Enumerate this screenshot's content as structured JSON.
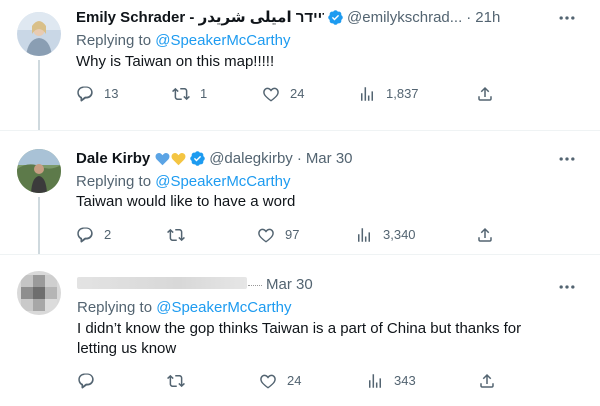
{
  "tweets": [
    {
      "name": "Emily Schrader - אמילי שריידר امیلی شریدر",
      "handle": "@emilykschrad...",
      "time": "21h",
      "replying_label": "Replying to ",
      "replying_to": "@SpeakerMcCarthy",
      "text": "Why is Taiwan on this map!!!!!",
      "replies": "13",
      "retweets": "1",
      "likes": "24",
      "views": "1,837"
    },
    {
      "name": "Dale Kirby",
      "handle": "@dalegkirby",
      "time": "Mar 30",
      "replying_label": "Replying to ",
      "replying_to": "@SpeakerMcCarthy",
      "text": "Taiwan would like to have a word",
      "replies": "2",
      "retweets": "",
      "likes": "97",
      "views": "3,340"
    },
    {
      "name": "",
      "handle": "",
      "time": "Mar 30",
      "replying_label": "Replying to ",
      "replying_to": "@SpeakerMcCarthy",
      "text_line1": "I didn’t know the gop thinks Taiwan is a part of China but thanks for",
      "text_line2": "letting us know",
      "replies": "",
      "retweets": "",
      "likes": "24",
      "views": "343"
    }
  ],
  "colors": {
    "accent": "#1d9bf0",
    "secondary_text": "#536471",
    "primary_text": "#0f1419",
    "heart_blue": "#5ba4e5",
    "heart_yellow": "#f4c542"
  },
  "icons": [
    "reply-icon",
    "retweet-icon",
    "like-icon",
    "views-icon",
    "share-icon",
    "more-icon",
    "verified-badge-icon"
  ]
}
